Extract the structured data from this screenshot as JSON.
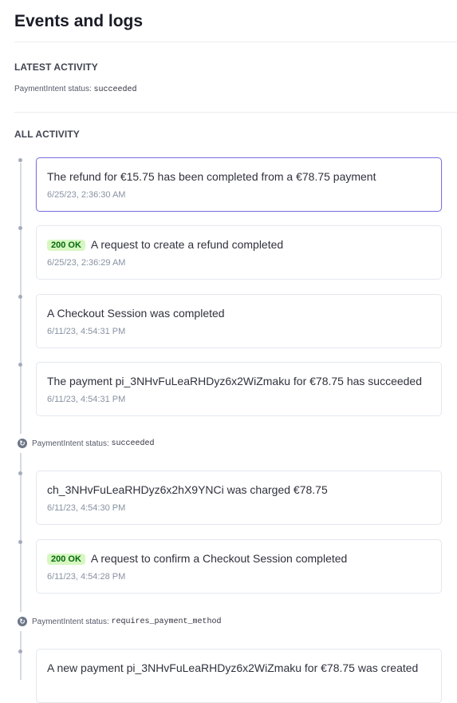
{
  "page": {
    "title": "Events and logs"
  },
  "latest": {
    "label": "LATEST ACTIVITY",
    "status_prefix": "PaymentIntent status:",
    "status_value": "succeeded"
  },
  "all": {
    "label": "ALL ACTIVITY"
  },
  "events": [
    {
      "title": "The refund for €15.75 has been completed from a €78.75 payment",
      "time": "6/25/23, 2:36:30 AM",
      "badge": ""
    },
    {
      "title": "A request to create a refund completed",
      "time": "6/25/23, 2:36:29 AM",
      "badge": "200 OK"
    },
    {
      "title": "A Checkout Session was completed",
      "time": "6/11/23, 4:54:31 PM",
      "badge": ""
    },
    {
      "title": "The payment pi_3NHvFuLeaRHDyz6x2WiZmaku for €78.75 has succeeded",
      "time": "6/11/23, 4:54:31 PM",
      "badge": ""
    },
    {
      "title": "ch_3NHvFuLeaRHDyz6x2hX9YNCi was charged €78.75",
      "time": "6/11/23, 4:54:30 PM",
      "badge": ""
    },
    {
      "title": "A request to confirm a Checkout Session completed",
      "time": "6/11/23, 4:54:28 PM",
      "badge": "200 OK"
    },
    {
      "title": "A new payment pi_3NHvFuLeaRHDyz6x2WiZmaku for €78.75 was created",
      "time": "",
      "badge": ""
    }
  ],
  "status_changes": [
    {
      "prefix": "PaymentIntent status:",
      "value": "succeeded"
    },
    {
      "prefix": "PaymentIntent status:",
      "value": "requires_payment_method"
    }
  ],
  "icons": {
    "status": "status-change-icon"
  },
  "colors": {
    "selected_border": "#7b73e0",
    "badge_bg": "#d7f7c2",
    "badge_text": "#05690d"
  }
}
